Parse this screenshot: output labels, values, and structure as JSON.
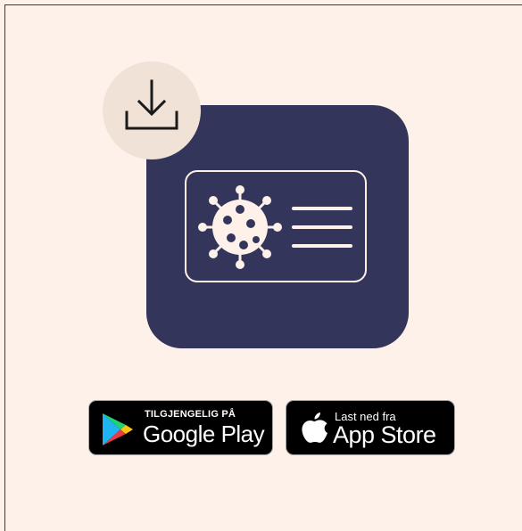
{
  "colors": {
    "background": "#fdf1ea",
    "tile": "#33365a",
    "badge_circle": "#f1e2d8",
    "store_badge": "#000000"
  },
  "illustration": {
    "tile_icon": "certificate-card-icon",
    "card_icons": [
      "virus-icon",
      "text-lines-icon"
    ],
    "badge_icon": "download-icon"
  },
  "store_buttons": {
    "google_play": {
      "small_text": "TILGJENGELIG PÅ",
      "big_text": "Google Play",
      "icon": "google-play-logo-icon"
    },
    "app_store": {
      "small_text": "Last ned fra",
      "big_text": "App Store",
      "icon": "apple-logo-icon"
    }
  }
}
